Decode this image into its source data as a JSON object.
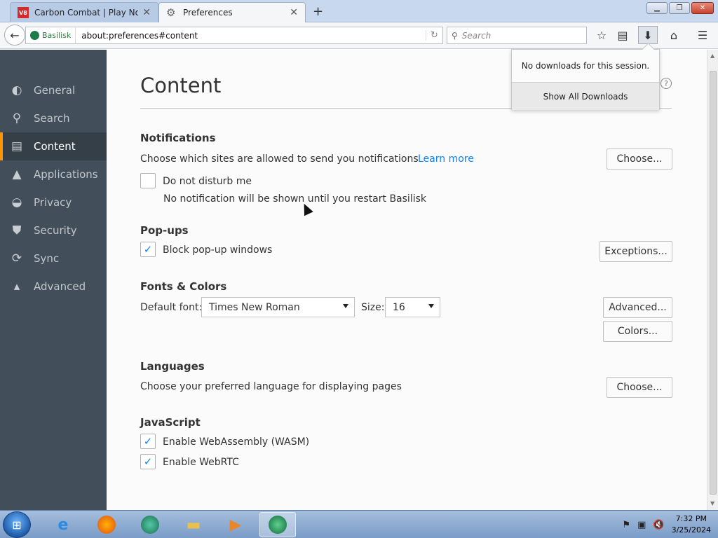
{
  "tabs": [
    {
      "title": "Carbon Combat | Play Now",
      "favicon": "V8",
      "active": false
    },
    {
      "title": "Preferences",
      "active": true
    }
  ],
  "toolbar": {
    "identity_label": "Basilisk",
    "url": "about:preferences#content",
    "search_placeholder": "Search"
  },
  "sidebar": {
    "items": [
      {
        "label": "General",
        "icon": "switch-icon"
      },
      {
        "label": "Search",
        "icon": "search-icon"
      },
      {
        "label": "Content",
        "icon": "document-icon",
        "selected": true
      },
      {
        "label": "Applications",
        "icon": "rocket-icon"
      },
      {
        "label": "Privacy",
        "icon": "mask-icon"
      },
      {
        "label": "Security",
        "icon": "shield-icon"
      },
      {
        "label": "Sync",
        "icon": "sync-icon"
      },
      {
        "label": "Advanced",
        "icon": "wizard-hat-icon"
      }
    ]
  },
  "content": {
    "title": "Content",
    "notifications": {
      "heading": "Notifications",
      "description": "Choose which sites are allowed to send you notifications",
      "learn_more": "Learn more",
      "choose_button": "Choose...",
      "dnd_label": "Do not disturb me",
      "dnd_checked": false,
      "dnd_note": "No notification will be shown until you restart Basilisk"
    },
    "popups": {
      "heading": "Pop-ups",
      "block_label": "Block pop-up windows",
      "block_checked": true,
      "exceptions_button": "Exceptions..."
    },
    "fonts": {
      "heading": "Fonts & Colors",
      "default_font_label": "Default font:",
      "default_font_value": "Times New Roman",
      "size_label": "Size:",
      "size_value": "16",
      "advanced_button": "Advanced...",
      "colors_button": "Colors..."
    },
    "languages": {
      "heading": "Languages",
      "description": "Choose your preferred language for displaying pages",
      "choose_button": "Choose..."
    },
    "javascript": {
      "heading": "JavaScript",
      "wasm_label": "Enable WebAssembly (WASM)",
      "wasm_checked": true,
      "webrtc_label": "Enable WebRTC",
      "webrtc_checked": true
    }
  },
  "downloads_panel": {
    "message": "No downloads for this session.",
    "show_all": "Show All Downloads"
  },
  "taskbar": {
    "time": "7:32 PM",
    "date": "3/25/2024"
  },
  "colors": {
    "accent": "#0a84ff",
    "sidebar_bg": "#424f5a",
    "selection_marker": "#ff9500"
  }
}
